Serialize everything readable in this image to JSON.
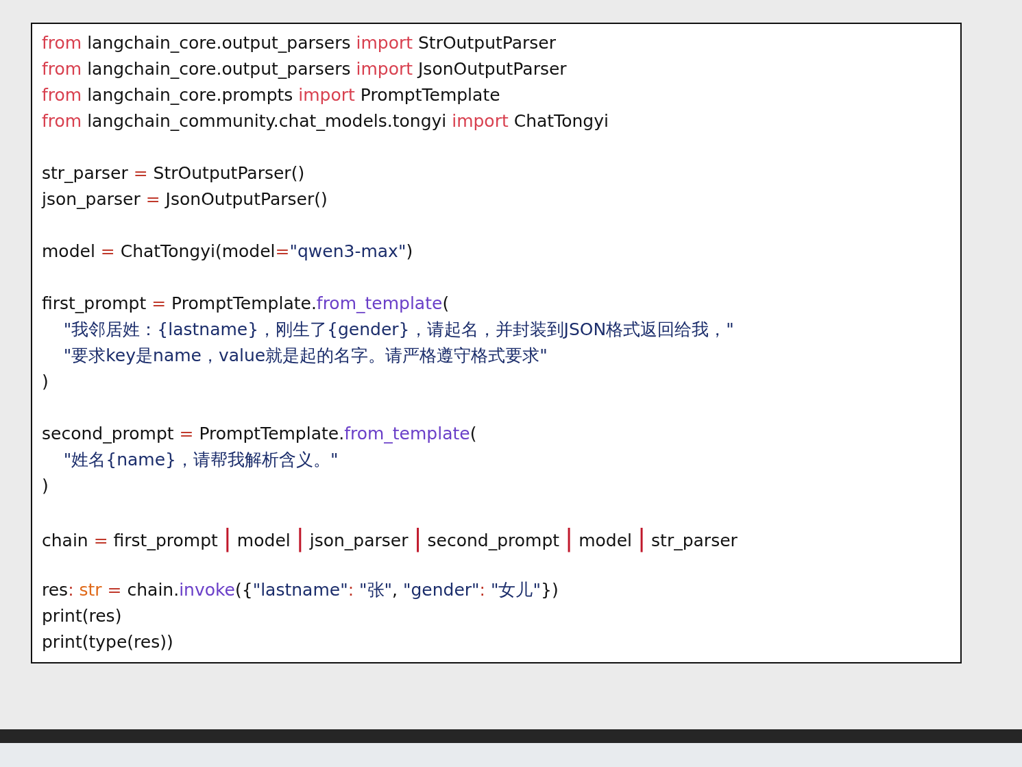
{
  "code_blocks": [
    [
      [
        {
          "kind": "keyword",
          "text": "from"
        },
        {
          "kind": "plain",
          "text": " langchain_core.output_parsers "
        },
        {
          "kind": "keyword",
          "text": "import"
        },
        {
          "kind": "plain",
          "text": " StrOutputParser"
        }
      ],
      [
        {
          "kind": "keyword",
          "text": "from"
        },
        {
          "kind": "plain",
          "text": " langchain_core.output_parsers "
        },
        {
          "kind": "keyword",
          "text": "import"
        },
        {
          "kind": "plain",
          "text": " JsonOutputParser"
        }
      ],
      [
        {
          "kind": "keyword",
          "text": "from"
        },
        {
          "kind": "plain",
          "text": " langchain_core.prompts "
        },
        {
          "kind": "keyword",
          "text": "import"
        },
        {
          "kind": "plain",
          "text": " PromptTemplate"
        }
      ],
      [
        {
          "kind": "keyword",
          "text": "from"
        },
        {
          "kind": "plain",
          "text": " langchain_community.chat_models.tongyi "
        },
        {
          "kind": "keyword",
          "text": "import"
        },
        {
          "kind": "plain",
          "text": " ChatTongyi"
        }
      ]
    ],
    [
      [
        {
          "kind": "plain",
          "text": "str_parser "
        },
        {
          "kind": "operator",
          "text": "="
        },
        {
          "kind": "plain",
          "text": " StrOutputParser()"
        }
      ],
      [
        {
          "kind": "plain",
          "text": "json_parser "
        },
        {
          "kind": "operator",
          "text": "="
        },
        {
          "kind": "plain",
          "text": " JsonOutputParser()"
        }
      ]
    ],
    [
      [
        {
          "kind": "plain",
          "text": "model "
        },
        {
          "kind": "operator",
          "text": "="
        },
        {
          "kind": "plain",
          "text": " ChatTongyi(model"
        },
        {
          "kind": "operator",
          "text": "="
        },
        {
          "kind": "string",
          "text": "\"qwen3-max\""
        },
        {
          "kind": "plain",
          "text": ")"
        }
      ]
    ],
    [
      [
        {
          "kind": "plain",
          "text": "first_prompt "
        },
        {
          "kind": "operator",
          "text": "="
        },
        {
          "kind": "plain",
          "text": " PromptTemplate."
        },
        {
          "kind": "function",
          "text": "from_template"
        },
        {
          "kind": "plain",
          "text": "("
        }
      ],
      [
        {
          "kind": "string",
          "text": "    \"我邻居姓：{lastname}，刚生了{gender}，请起名，并封装到JSON格式返回给我，\""
        }
      ],
      [
        {
          "kind": "string",
          "text": "    \"要求key是name，value就是起的名字。请严格遵守格式要求\""
        }
      ],
      [
        {
          "kind": "plain",
          "text": ")"
        }
      ]
    ],
    [
      [
        {
          "kind": "plain",
          "text": "second_prompt "
        },
        {
          "kind": "operator",
          "text": "="
        },
        {
          "kind": "plain",
          "text": " PromptTemplate."
        },
        {
          "kind": "function",
          "text": "from_template"
        },
        {
          "kind": "plain",
          "text": "("
        }
      ],
      [
        {
          "kind": "string",
          "text": "    \"姓名{name}，请帮我解析含义。\""
        }
      ],
      [
        {
          "kind": "plain",
          "text": ")"
        }
      ]
    ],
    [
      [
        {
          "kind": "plain",
          "text": "chain "
        },
        {
          "kind": "operator",
          "text": "="
        },
        {
          "kind": "plain",
          "text": " first_prompt "
        },
        {
          "kind": "pipe",
          "text": "|"
        },
        {
          "kind": "plain",
          "text": " model "
        },
        {
          "kind": "pipe",
          "text": "|"
        },
        {
          "kind": "plain",
          "text": " json_parser "
        },
        {
          "kind": "pipe",
          "text": "|"
        },
        {
          "kind": "plain",
          "text": " second_prompt "
        },
        {
          "kind": "pipe",
          "text": "|"
        },
        {
          "kind": "plain",
          "text": " model "
        },
        {
          "kind": "pipe",
          "text": "|"
        },
        {
          "kind": "plain",
          "text": " str_parser"
        }
      ]
    ],
    [
      [
        {
          "kind": "plain",
          "text": "res"
        },
        {
          "kind": "operator",
          "text": ":"
        },
        {
          "kind": "type",
          "text": " str"
        },
        {
          "kind": "operator",
          "text": " ="
        },
        {
          "kind": "plain",
          "text": " chain."
        },
        {
          "kind": "function",
          "text": "invoke"
        },
        {
          "kind": "plain",
          "text": "({"
        },
        {
          "kind": "string",
          "text": "\"lastname\""
        },
        {
          "kind": "operator",
          "text": ":"
        },
        {
          "kind": "string",
          "text": " \"张\""
        },
        {
          "kind": "plain",
          "text": ", "
        },
        {
          "kind": "string",
          "text": "\"gender\""
        },
        {
          "kind": "operator",
          "text": ":"
        },
        {
          "kind": "string",
          "text": " \"女儿\""
        },
        {
          "kind": "plain",
          "text": "})"
        }
      ],
      [
        {
          "kind": "plain",
          "text": "print(res)"
        }
      ],
      [
        {
          "kind": "plain",
          "text": "print(type(res))"
        }
      ]
    ]
  ]
}
